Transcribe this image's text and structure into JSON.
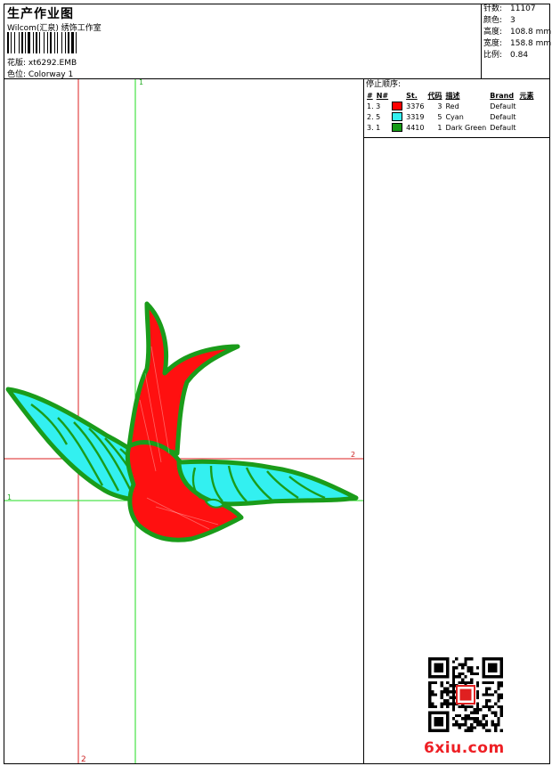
{
  "header": {
    "title": "生产作业图",
    "company": "Wilcom(汇泉) 绣饰工作室",
    "design_file": "花版: xt6292.EMB",
    "colorway": "色位: Colorway 1"
  },
  "stats": [
    {
      "label": "针数:",
      "value": "11107"
    },
    {
      "label": "颜色:",
      "value": "3"
    },
    {
      "label": "高度:",
      "value": "108.8 mm"
    },
    {
      "label": "宽度:",
      "value": "158.8 mm"
    },
    {
      "label": "比例:",
      "value": "0.84"
    }
  ],
  "stop_sequence": {
    "title": "停止顺序:",
    "columns": [
      "#",
      "N#",
      "St.",
      "代码",
      "描述",
      "Brand",
      "元素"
    ],
    "rows": [
      {
        "index": "1. 3",
        "stitches": "3376",
        "code": "3",
        "description": "Red",
        "brand": "Default",
        "color": "#ff0000"
      },
      {
        "index": "2. 5",
        "stitches": "3319",
        "code": "5",
        "description": "Cyan",
        "brand": "Default",
        "color": "#33f0f0"
      },
      {
        "index": "3. 1",
        "stitches": "4410",
        "code": "1",
        "description": "Dark Green",
        "brand": "Default",
        "color": "#169b16"
      }
    ]
  },
  "guides": {
    "green_vertical_label": "1",
    "green_horizontal_label": "1",
    "red_horizontal_label": "2",
    "red_vertical_label": "2"
  },
  "watermark": "6xiu.com"
}
